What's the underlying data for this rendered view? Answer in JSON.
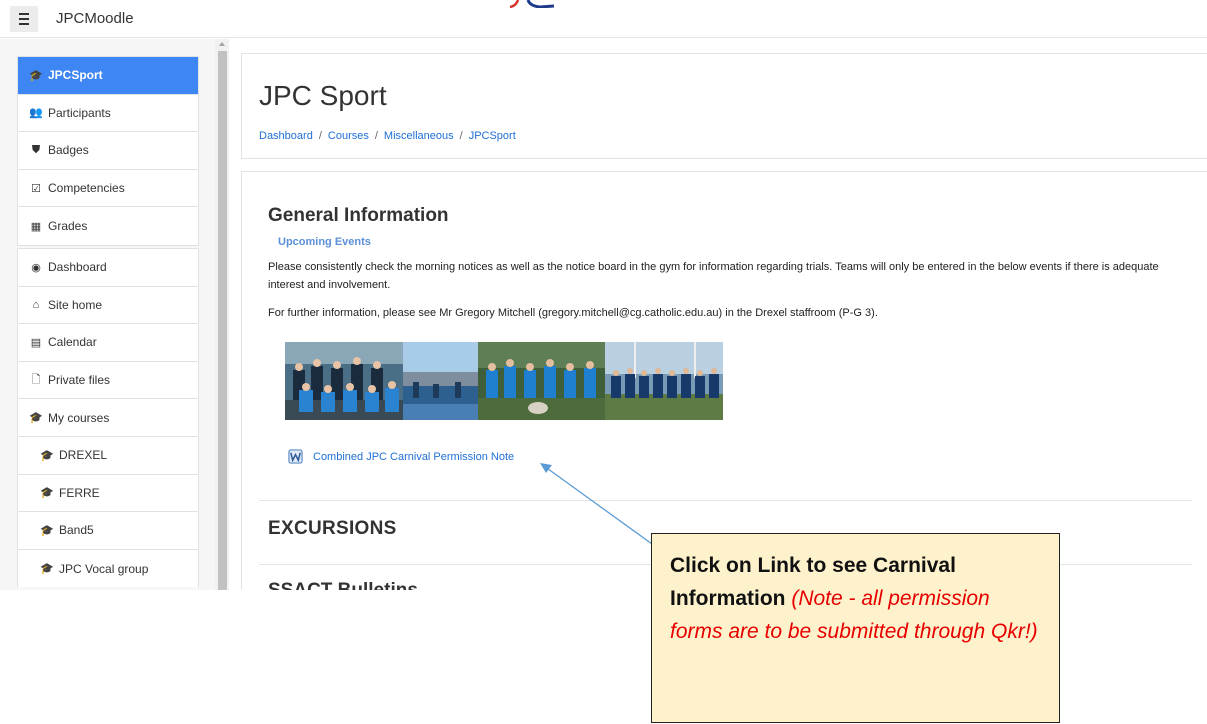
{
  "app": {
    "brand": "JPCMoodle"
  },
  "sidebar": {
    "course_group": [
      {
        "label": "JPCSport",
        "icon": "graduation-cap-icon",
        "active": true
      },
      {
        "label": "Participants",
        "icon": "users-icon"
      },
      {
        "label": "Badges",
        "icon": "shield-icon"
      },
      {
        "label": "Competencies",
        "icon": "checkbox-icon"
      },
      {
        "label": "Grades",
        "icon": "table-icon"
      }
    ],
    "site_group": [
      {
        "label": "Dashboard",
        "icon": "dashboard-icon"
      },
      {
        "label": "Site home",
        "icon": "home-icon"
      },
      {
        "label": "Calendar",
        "icon": "calendar-icon"
      },
      {
        "label": "Private files",
        "icon": "file-icon"
      },
      {
        "label": "My courses",
        "icon": "graduation-cap-icon"
      },
      {
        "label": "DREXEL",
        "icon": "graduation-cap-icon"
      },
      {
        "label": "FERRE",
        "icon": "graduation-cap-icon"
      },
      {
        "label": "Band5",
        "icon": "graduation-cap-icon"
      },
      {
        "label": "JPC Vocal group",
        "icon": "graduation-cap-icon"
      }
    ]
  },
  "header": {
    "title": "JPC Sport",
    "breadcrumb": [
      "Dashboard",
      "Courses",
      "Miscellaneous",
      "JPCSport"
    ],
    "breadcrumb_separator": "/"
  },
  "main": {
    "section_title": "General Information",
    "upcoming_label": "Upcoming Events",
    "paragraph1": "Please consistently check the morning notices as well as the notice board in the gym for information regarding trials. Teams will only be entered in the below events if there is adequate interest and involvement.",
    "paragraph2": "For further information, please see Mr Gregory Mitchell (gregory.mitchell@cg.catholic.edu.au) in the Drexel staffroom (P-G 3).",
    "resource_link": "Combined JPC Carnival Permission Note",
    "section2_title": "EXCURSIONS",
    "section3_title": "SSACT Bulletins"
  },
  "annotation": {
    "bold_text": "Click on Link to see Carnival Information",
    "red_text": "(Note - all permission forms are to be submitted through Qkr!)"
  },
  "colors": {
    "active_nav": "#3f86f5",
    "link": "#1f6fd6",
    "callout_bg": "#fef2cc",
    "callout_red": "#e60000",
    "arrow": "#5b9bd5"
  }
}
